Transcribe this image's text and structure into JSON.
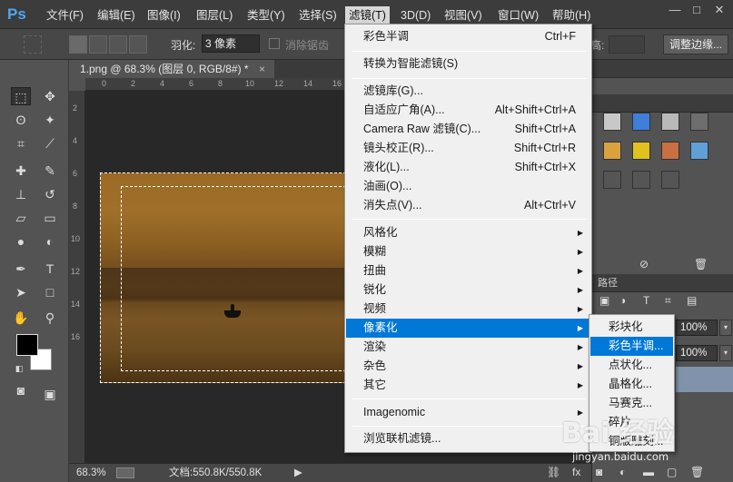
{
  "app": {
    "logo": "Ps",
    "window_controls": [
      "—",
      "□",
      "✕"
    ]
  },
  "menubar": {
    "items": [
      "文件(F)",
      "编辑(E)",
      "图像(I)",
      "图层(L)",
      "类型(Y)",
      "选择(S)",
      "滤镜(T)",
      "3D(D)",
      "视图(V)",
      "窗口(W)",
      "帮助(H)"
    ],
    "active_index": 6
  },
  "options": {
    "feather_label": "羽化:",
    "feather_value": "3 像素",
    "antialias_label": "消除锯齿",
    "refine_edge_label": "调整边缘...",
    "right_label": "高:"
  },
  "document": {
    "tab_title": "1.png @ 68.3% (图层 0, RGB/8#) *",
    "tab_close": "×"
  },
  "ruler_top_ticks": [
    "0",
    "2",
    "4",
    "6",
    "8",
    "10",
    "12",
    "14",
    "16"
  ],
  "ruler_left_ticks": [
    "2",
    "4",
    "6",
    "8",
    "10",
    "12",
    "14",
    "16"
  ],
  "statusbar": {
    "zoom": "68.3%",
    "doc_size": "文档:550.8K/550.8K",
    "arrow": "▶"
  },
  "filter_menu": {
    "top_items": [
      {
        "label": "彩色半调",
        "shortcut": "Ctrl+F"
      }
    ],
    "convert": [
      {
        "label": "转换为智能滤镜(S)",
        "shortcut": ""
      }
    ],
    "gallery_items": [
      {
        "label": "滤镜库(G)...",
        "shortcut": ""
      },
      {
        "label": "自适应广角(A)...",
        "shortcut": "Alt+Shift+Ctrl+A"
      },
      {
        "label": "Camera Raw 滤镜(C)...",
        "shortcut": "Shift+Ctrl+A"
      },
      {
        "label": "镜头校正(R)...",
        "shortcut": "Shift+Ctrl+R"
      },
      {
        "label": "液化(L)...",
        "shortcut": "Shift+Ctrl+X"
      },
      {
        "label": "油画(O)...",
        "shortcut": ""
      },
      {
        "label": "消失点(V)...",
        "shortcut": "Alt+Ctrl+V"
      }
    ],
    "submenu_items": [
      "风格化",
      "模糊",
      "扭曲",
      "锐化",
      "视频",
      "像素化",
      "渲染",
      "杂色",
      "其它"
    ],
    "submenu_highlight_index": 5,
    "plugin_items": [
      "Imagenomic"
    ],
    "browse_items": [
      "浏览联机滤镜..."
    ],
    "submenu_arrow": "▶"
  },
  "pixelate_submenu": {
    "items": [
      "彩块化",
      "彩色半调...",
      "点状化...",
      "晶格化...",
      "马赛克...",
      "碎片",
      "铜版雕刻..."
    ],
    "highlight_index": 1
  },
  "right_panels": {
    "header_label": "路径",
    "opacity_value": "100%",
    "fill_value": "100%"
  },
  "swatch_colors": [
    "#c8c8c8",
    "#3f7fd9",
    "#b9b9b9",
    "#6e6e6e",
    "#e7c23e",
    "#e0a81e",
    "#c87040",
    "#5fa0d8"
  ],
  "watermark": {
    "logo": "Bai 经验",
    "url": "jingyan.baidu.com"
  }
}
